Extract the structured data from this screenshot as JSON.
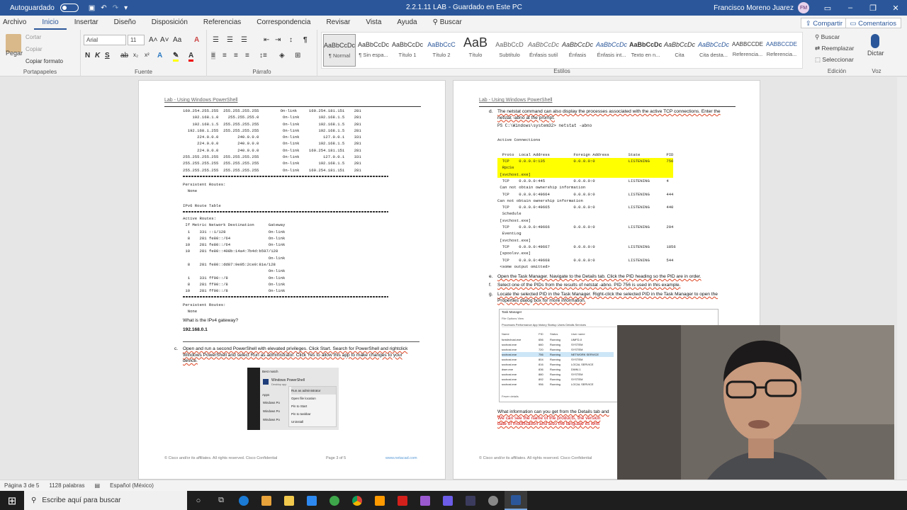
{
  "titlebar": {
    "autosave_label": "Autoguardado",
    "center_title": "2.2.1.11 LAB  -  Guardado en Este PC",
    "user": "Francisco Moreno Juarez",
    "initials": "FM"
  },
  "menu": {
    "tabs": [
      "Archivo",
      "Inicio",
      "Insertar",
      "Diseño",
      "Disposición",
      "Referencias",
      "Correspondencia",
      "Revisar",
      "Vista",
      "Ayuda"
    ],
    "search": "Buscar",
    "share": "Compartir",
    "comments": "Comentarios"
  },
  "ribbon": {
    "clipboard": {
      "paste": "Pegar",
      "cut": "Cortar",
      "copy": "Copiar",
      "format": "Copiar formato",
      "label": "Portapapeles"
    },
    "font": {
      "name": "Arial",
      "size": "11",
      "label": "Fuente"
    },
    "paragraph": {
      "label": "Párrafo"
    },
    "styles": {
      "label": "Estilos",
      "items": [
        {
          "preview": "AaBbCcDc",
          "name": "¶ Normal"
        },
        {
          "preview": "AaBbCcDc",
          "name": "¶ Sin espa..."
        },
        {
          "preview": "AaBbCcDc",
          "name": "Título 1"
        },
        {
          "preview": "AaBbCcC",
          "name": "Título 2"
        },
        {
          "preview": "AaB",
          "name": "Título"
        },
        {
          "preview": "AaBbCcD",
          "name": "Subtítulo"
        },
        {
          "preview": "AaBbCcDc",
          "name": "Énfasis sutil"
        },
        {
          "preview": "AaBbCcDc",
          "name": "Énfasis"
        },
        {
          "preview": "AaBbCcDc",
          "name": "Énfasis int..."
        },
        {
          "preview": "AaBbCcDc",
          "name": "Texto en n..."
        },
        {
          "preview": "AaBbCcDc",
          "name": "Cita"
        },
        {
          "preview": "AaBbCcDc",
          "name": "Cita desta..."
        },
        {
          "preview": "AABBCCDE",
          "name": "Referencia..."
        },
        {
          "preview": "AABBCCDE",
          "name": "Referencia..."
        }
      ]
    },
    "editing": {
      "find": "Buscar",
      "replace": "Reemplazar",
      "select": "Seleccionar",
      "label": "Edición"
    },
    "voice": {
      "dictate": "Dictar",
      "label": "Voz"
    }
  },
  "page_left": {
    "header": "Lab - Using Windows PowerShell",
    "route_lines": "169.254.255.255  255.255.255.255         On-link     169.254.181.151    281\n    192.168.1.0    255.255.255.0          On-link        192.168.1.5    281\n    192.168.1.5  255.255.255.255          On-link        192.168.1.5    281\n  192.168.1.255  255.255.255.255          On-link        192.168.1.5    281\n      224.0.0.0        240.0.0.0          On-link          127.0.0.1    331\n      224.0.0.0        240.0.0.0          On-link        192.168.1.5    281\n      224.0.0.0        240.0.0.0          On-link    169.254.181.151    281\n255.255.255.255  255.255.255.255          On-link          127.0.0.1    331\n255.255.255.255  255.255.255.255          On-link        192.168.1.5    281\n255.255.255.255  255.255.255.255          On-link    169.254.181.151    281",
    "persistent_routes": "Persistent Routes:\n  None",
    "ipv6_title": "IPv6 Route Table",
    "active_routes": "Active Routes:\n If Metric Network Destination      Gateway\n  1    331 ::1/128                  On-link\n  8    281 fe80::/64                On-link\n 10    281 fe80::/64                On-link\n 10    281 fe80::408b:14a4:7b4d:b597/128\n                                    On-link\n  8    281 fe80::dd87:9e05:2ce0:81e/128\n                                    On-link\n  1    331 ff00::/8                 On-link\n  8    281 ff00::/8                 On-link\n 10    281 ff00::/8                 On-link",
    "persistent_routes2": "Persistent Routes:\n  None",
    "question": "What is the IPv4 gateway?",
    "answer": "192.168.0.1",
    "step_c_label": "c.",
    "step_c": "Open and run a second PowerShell with elevated privileges. Click Start. Search for PowerShell and rightclick Windows PowerShell and select Run as administrator. Click Yes to allow this app to make changes to your device.",
    "ctx_best_match": "Best match",
    "ctx_app": "Windows PowerShell",
    "ctx_app_sub": "Desktop app",
    "ctx_apps": "Apps",
    "ctx_menu": [
      "Run as administrator",
      "Open file location",
      "Pin to Start",
      "Pin to taskbar",
      "Uninstall"
    ],
    "ctx_apps_list": [
      "Windows Po",
      "Windows Po",
      "Windows Po"
    ],
    "footer_left": "© Cisco and/or its affiliates. All rights reserved. Cisco Confidential",
    "footer_page": "Page 3 of 5",
    "footer_url": "www.netacad.com"
  },
  "page_right": {
    "header": "Lab - Using Windows PowerShell",
    "step_d_label": "d.",
    "step_d": "The netstat command can also display the processes associated with the active TCP connections. Enter the netstat -abno at the prompt.",
    "prompt": "PS C:\\Windows\\system32> netstat -abno",
    "conn_title": "Active Connections",
    "conn_header": "  Proto  Local Address          Foreign Address        State           PID",
    "conn_highlight": "  TCP    0.0.0.0:135            0.0.0.0:0              LISTENING       756\n  RpcSs\n [svchost.exe]",
    "conn_lines": "  TCP    0.0.0.0:445            0.0.0.0:0              LISTENING       4\n Can not obtain ownership information\n  TCP    0.0.0.0:49664          0.0.0.0:0              LISTENING       444\nCan not obtain ownership information\n  TCP    0.0.0.0:49665          0.0.0.0:0              LISTENING       440\n  Schedule\n [svchost.exe]\n  TCP    0.0.0.0:49666          0.0.0.0:0              LISTENING       204\n  EventLog\n [svchost.exe]\n  TCP    0.0.0.0:49667          0.0.0.0:0              LISTENING       1856\n [spoolsv.exe]\n  TCP    0.0.0.0:49668          0.0.0.0:0              LISTENING       544\n <some output omitted>",
    "step_e_label": "e.",
    "step_e": "Open the Task Manager. Navigate to the Details tab. Click the PID heading so the PID are in order.",
    "step_f_label": "f.",
    "step_f": "Select one of the PIDs from the results of netstat -abno. PID 756 is used in this example.",
    "step_g_label": "g.",
    "step_g": "Locate the selected PID in the Task Manager. Right-click the selected PID in the Task Manager to open the Properties dialog box for more information.",
    "tm_title": "Task Manager",
    "tm_menu": "File   Options   View",
    "tm_tabs": "Processes   Performance   App history   Startup   Users   Details   Services",
    "tm_header": [
      "Name",
      "PID",
      "Status",
      "User name"
    ],
    "tm_rows": [
      [
        "fontdrvhost.exe",
        "656",
        "Running",
        "UMFD-0"
      ],
      [
        "svchost.exe",
        "660",
        "Running",
        "SYSTEM"
      ],
      [
        "svchost.exe",
        "720",
        "Running",
        "SYSTEM"
      ],
      [
        "svchost.exe",
        "756",
        "Running",
        "NETWORK SERVICE"
      ],
      [
        "svchost.exe",
        "804",
        "Running",
        "SYSTEM"
      ],
      [
        "svchost.exe",
        "816",
        "Running",
        "LOCAL SERVICE"
      ],
      [
        "dwm.exe",
        "836",
        "Running",
        "DWM-1"
      ],
      [
        "svchost.exe",
        "880",
        "Running",
        "SYSTEM"
      ],
      [
        "svchost.exe",
        "892",
        "Running",
        "SYSTEM"
      ],
      [
        "svchost.exe",
        "956",
        "Running",
        "LOCAL SERVICE"
      ]
    ],
    "tm_fewer": "Fewer details",
    "q_line1": "What information can you get from the Details tab and",
    "a_line1": "We can see the name of the products, the version",
    "a_line2": "date of modification and also the languaje its writt",
    "footer_left": "© Cisco and/or its affiliates. All rights reserved. Cisco Confidential"
  },
  "status": {
    "page": "Página 3 de 5",
    "words": "1128 palabras",
    "lang": "Español (México)"
  },
  "taskbar": {
    "search_placeholder": "Escribe aquí para buscar"
  },
  "colors": {
    "accent": "#2b579a",
    "highlight": "#ffff00"
  }
}
